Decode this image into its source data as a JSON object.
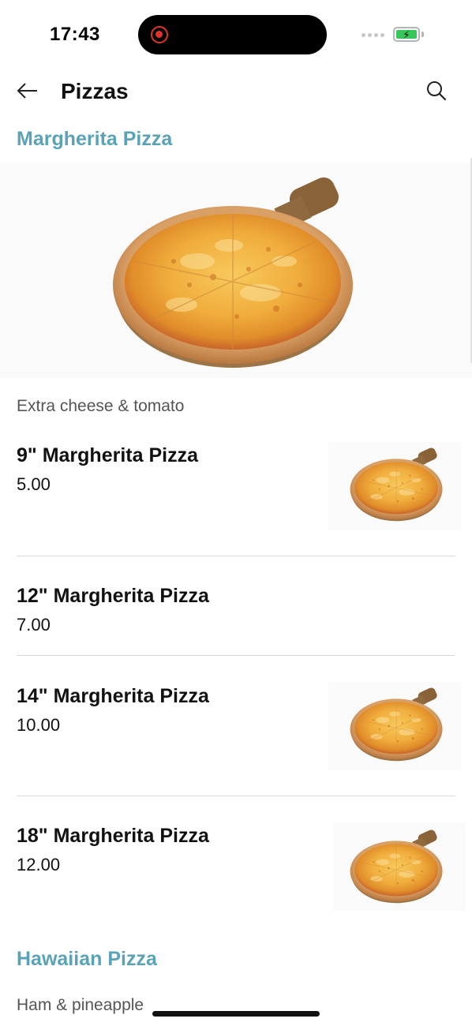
{
  "status_bar": {
    "time": "17:43",
    "recording_indicator": "recording-dot-icon",
    "battery_color": "#35c759"
  },
  "header": {
    "title": "Pizzas",
    "back_icon": "arrow-left-icon",
    "search_icon": "search-icon"
  },
  "sections": [
    {
      "title": "Margherita Pizza",
      "description": "Extra cheese & tomato",
      "items": [
        {
          "name": "9\" Margherita Pizza",
          "price": "5.00"
        },
        {
          "name": "12\" Margherita Pizza",
          "price": "7.00"
        },
        {
          "name": "14\" Margherita Pizza",
          "price": "10.00"
        },
        {
          "name": "18\" Margherita Pizza",
          "price": "12.00"
        }
      ]
    },
    {
      "title": "Hawaiian Pizza",
      "description": "Ham & pineapple",
      "items": []
    }
  ],
  "colors": {
    "accent": "#5aa3b7",
    "text": "#111111",
    "muted": "#555555",
    "divider": "#dadada"
  }
}
